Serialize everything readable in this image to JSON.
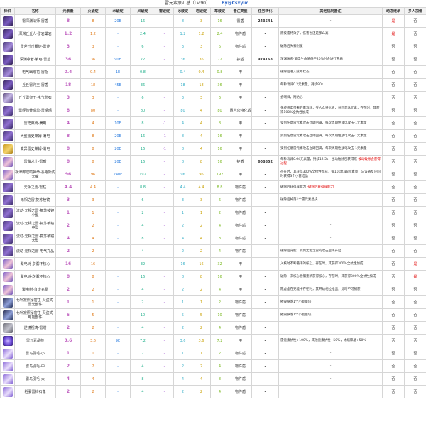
{
  "header": {
    "title": "雷元素原汇总（Lv.90）",
    "author": "By@Csxylic"
  },
  "columns": [
    "标识",
    "名称",
    "元素量",
    "火破绽",
    "水破绽",
    "风破绽",
    "雷破绽",
    "冰破绽",
    "岩破绽",
    "草破绽",
    "备注类型",
    "任务转化",
    "其他机制备注",
    "动态继承",
    "多人加值"
  ],
  "rows": [
    {
      "icon": "boss",
      "name": "雷深渊法师-雷盾",
      "el": "8",
      "fire": "8",
      "water": "20E",
      "wind": "16",
      "thunder": "-",
      "ice": "8",
      "rock": "3",
      "grass": "16",
      "type": "雷盾",
      "task": "243541",
      "note": "-",
      "note_hl": "",
      "dyn": "是",
      "multi": "否",
      "dyn_red": true
    },
    {
      "icon": "boss",
      "name": "深渊丘丘人·雷岩巢岩",
      "el": "1.2",
      "fire": "1.2",
      "water": "-",
      "wind": "2.4",
      "thunder": "-",
      "ice": "1.2",
      "rock": "1.2",
      "grass": "2.4",
      "type": "物件盾",
      "task": "-",
      "note": "而按雷特效了，伤害也还是那么高",
      "note_hl": "",
      "dyn": "是",
      "multi": "否",
      "dyn_red": true
    },
    {
      "icon": "plant",
      "name": "雷斧丘丘暴徒-雷斧",
      "el": "3",
      "fire": "3",
      "water": "-",
      "wind": "6",
      "thunder": "-",
      "ice": "3",
      "rock": "3",
      "grass": "6",
      "type": "物件盾",
      "task": "-",
      "note": "破除后失去附魔",
      "note_hl": "",
      "dyn": "否",
      "multi": "否",
      "dyn_red": false
    },
    {
      "icon": "boss",
      "name": "深渊咏者·紫电-雷盾",
      "el": "36",
      "fire": "36",
      "water": "90E",
      "wind": "72",
      "thunder": "-",
      "ice": "36",
      "rock": "36",
      "grass": "72",
      "type": "护盾",
      "task": "974163",
      "note": "深渊咏者·紫电生命值低于20%时会进行开盾",
      "note_hl": "",
      "dyn": "否",
      "multi": "否",
      "dyn_red": false
    },
    {
      "icon": "plant",
      "name": "电气幽魂花-雷瓶",
      "el": "0.4",
      "fire": "0.4",
      "water": "1E",
      "wind": "0.8",
      "thunder": "-",
      "ice": "0.4",
      "rock": "0.4",
      "grass": "0.8",
      "type": "甲",
      "task": "-",
      "note": "破除后进入眩晕状态",
      "note_hl": "",
      "dyn": "否",
      "multi": "否",
      "dyn_red": false
    },
    {
      "icon": "boss",
      "name": "丘丘雷兜王-雷盾",
      "el": "18",
      "fire": "18",
      "water": "45E",
      "wind": "36",
      "thunder": "-",
      "ice": "18",
      "rock": "18",
      "grass": "36",
      "type": "甲",
      "task": "-",
      "note": "每秒衰减0.2元素量，持续90s",
      "note_hl": "",
      "dyn": "否",
      "multi": "否",
      "dyn_red": false
    },
    {
      "icon": "skull",
      "name": "丘丘雷兜王·电气防石",
      "el": "3",
      "fire": "3",
      "water": "-",
      "wind": "6",
      "thunder": "-",
      "ice": "3",
      "rock": "3",
      "grass": "6",
      "type": "甲",
      "task": "-",
      "note": "会嘲讽，附防心",
      "note_hl": "",
      "dyn": "否",
      "multi": "否",
      "dyn_red": false
    },
    {
      "icon": "chest",
      "name": "雷蛭骸骨晴单-雷晴晴",
      "el": "8",
      "fire": "80",
      "water": "-",
      "wind": "80",
      "thunder": "-",
      "ice": "80",
      "rock": "4",
      "grass": "80",
      "type": "愚人众特化盾",
      "task": "-",
      "note": "免疫感电带来的雷消耗，受人众特化盾，剩点是冰元素，存在时，其获得100%全抗性加成",
      "note_hl": "",
      "dyn": "否",
      "multi": "否",
      "dyn_red": false
    },
    {
      "icon": "chest",
      "name": "雷史莱姆-满电",
      "el": "4",
      "fire": "4",
      "water": "10E",
      "wind": "8",
      "thunder": "-1",
      "ice": "4",
      "rock": "4",
      "grass": "8",
      "type": "甲",
      "task": "-",
      "note": "受到任意雷元素攻击立即回满，每次周期性放电攻击-1元素量",
      "note_hl": "",
      "dyn": "否",
      "multi": "否",
      "dyn_red": false
    },
    {
      "icon": "chest",
      "name": "大型雷史莱姆-满电",
      "el": "8",
      "fire": "8",
      "water": "20E",
      "wind": "16",
      "thunder": "-1",
      "ice": "8",
      "rock": "4",
      "grass": "16",
      "type": "甲",
      "task": "-",
      "note": "受到任意雷元素攻击立即回满，每次周期性放电攻击-1元素量",
      "note_hl": "",
      "dyn": "否",
      "multi": "否",
      "dyn_red": false
    },
    {
      "icon": "gold",
      "name": "变异雷史莱姆-满电",
      "el": "8",
      "fire": "8",
      "water": "20E",
      "wind": "16",
      "thunder": "-1",
      "ice": "8",
      "rock": "4",
      "grass": "16",
      "type": "甲",
      "task": "-",
      "note": "受到任意雷元素攻击立即回满，每次周期性放电攻击-1元素量",
      "note_hl": "",
      "dyn": "否",
      "multi": "否",
      "dyn_red": false
    },
    {
      "icon": "girl",
      "name": "雷萤术士-雷盾",
      "el": "8",
      "fire": "8",
      "water": "20E",
      "wind": "16",
      "thunder": "-",
      "ice": "8",
      "rock": "8",
      "grass": "16",
      "type": "护盾",
      "task": "608852",
      "note": "每秒衰减0.64元素量，持续12.5s，主动破除已获得或",
      "note_hl": "被动破除会获得过程",
      "dyn": "否",
      "multi": "否",
      "dyn_red": false
    },
    {
      "icon": "girl",
      "name": "祸津御建鸣神命-恶曜斯内天魔",
      "el": "96",
      "fire": "96",
      "water": "240E",
      "wind": "192",
      "thunder": "-",
      "ice": "96",
      "rock": "96",
      "grass": "192",
      "type": "甲",
      "task": "-",
      "note": "存在时，其获得300%全抗性加成，每10s衰减8元素量，与该盾反应同时获得3个小雷结晶",
      "note_hl": "",
      "dyn": "否",
      "multi": "否",
      "dyn_red": false
    },
    {
      "icon": "chest",
      "name": "无相之雷·雷柱",
      "el": "4.4",
      "fire": "4.4",
      "water": "-",
      "wind": "8.8",
      "thunder": "-",
      "ice": "4.4",
      "rock": "4.4",
      "grass": "8.8",
      "type": "物件盾",
      "task": "-",
      "note": "破除后获得或能力",
      "note_hl": "-破除后获得或能力",
      "dyn": "否",
      "multi": "否",
      "dyn_red": false
    },
    {
      "icon": "chest",
      "name": "无相之雷·复苏棱镜",
      "el": "3",
      "fire": "3",
      "water": "-",
      "wind": "6",
      "thunder": "-",
      "ice": "3",
      "rock": "3",
      "grass": "6",
      "type": "物件盾",
      "task": "-",
      "note": "破除后掉落1个雷元素晶块",
      "note_hl": "",
      "dyn": "否",
      "multi": "否",
      "dyn_red": false
    },
    {
      "icon": "chest",
      "name": "流动·无相之雷·复苏棱镜小型",
      "el": "1",
      "fire": "1",
      "water": "-",
      "wind": "2",
      "thunder": "-",
      "ice": "1",
      "rock": "1",
      "grass": "2",
      "type": "物件盾",
      "task": "-",
      "note": "-",
      "note_hl": "",
      "dyn": "否",
      "multi": "否",
      "dyn_red": false
    },
    {
      "icon": "chest",
      "name": "流动·无相之雷·复苏棱镜中型",
      "el": "2",
      "fire": "2",
      "water": "-",
      "wind": "4",
      "thunder": "-",
      "ice": "2",
      "rock": "2",
      "grass": "4",
      "type": "物件盾",
      "task": "-",
      "note": "-",
      "note_hl": "",
      "dyn": "否",
      "multi": "否",
      "dyn_red": false
    },
    {
      "icon": "chest",
      "name": "流动·无相之雷·复苏棱镜大型",
      "el": "4",
      "fire": "4",
      "water": "-",
      "wind": "8",
      "thunder": "-",
      "ice": "4",
      "rock": "4",
      "grass": "8",
      "type": "物件盾",
      "task": "-",
      "note": "-",
      "note_hl": "",
      "dyn": "否",
      "multi": "否",
      "dyn_red": false
    },
    {
      "icon": "chest",
      "name": "流动·无相之雷·电气充晶",
      "el": "2",
      "fire": "2",
      "water": "-",
      "wind": "4",
      "thunder": "-",
      "ice": "2",
      "rock": "2",
      "grass": "4",
      "type": "物件盾",
      "task": "-",
      "note": "破除后充能，受到无相之雷的攻击后再开启",
      "note_hl": "",
      "dyn": "否",
      "multi": "否",
      "dyn_red": false
    },
    {
      "icon": "girl",
      "name": "聚电树-泉循环核心",
      "el": "16",
      "fire": "16",
      "water": "-",
      "wind": "32",
      "thunder": "-",
      "ice": "16",
      "rock": "16",
      "grass": "32",
      "type": "甲",
      "task": "-",
      "note": "入核时不断循环的核心，存在时，其获得300%全抗性加成",
      "note_hl": "",
      "dyn": "否",
      "multi": "是",
      "dyn_red": false
    },
    {
      "icon": "girl",
      "name": "聚电树-次循环核心",
      "el": "8",
      "fire": "8",
      "water": "-",
      "wind": "16",
      "thunder": "-",
      "ice": "8",
      "rock": "8",
      "grass": "16",
      "type": "甲",
      "task": "-",
      "note": "破除一次核心恐惧重新获得核心，存在时，其获得300%全抗性加成",
      "note_hl": "",
      "dyn": "否",
      "multi": "是",
      "dyn_red": false
    },
    {
      "icon": "girl",
      "name": "聚电树-直虚充晶",
      "el": "2",
      "fire": "2",
      "water": "-",
      "wind": "4",
      "thunder": "-",
      "ice": "2",
      "rock": "2",
      "grass": "4",
      "type": "甲",
      "task": "-",
      "note": "陈虚虚在充能中存在时，其开始相拉推出，此时不可捕获",
      "note_hl": "",
      "dyn": "否",
      "multi": "否",
      "dyn_red": false
    },
    {
      "icon": "shrine",
      "name": "七叶寂照秘密主·灭盗式-雷光部件",
      "el": "1",
      "fire": "1",
      "water": "-",
      "wind": "2",
      "thunder": "-",
      "ice": "1",
      "rock": "1",
      "grass": "2",
      "type": "物件盾",
      "task": "-",
      "note": "摧毁掉落1个小能量块",
      "note_hl": "",
      "dyn": "否",
      "multi": "否",
      "dyn_red": false
    },
    {
      "icon": "shrine",
      "name": "七叶寂照秘密主·灭盗式-电能部件",
      "el": "5",
      "fire": "5",
      "water": "-",
      "wind": "10",
      "thunder": "-",
      "ice": "5",
      "rock": "5",
      "grass": "10",
      "type": "物件盾",
      "task": "-",
      "note": "摧毁掉落1个小能量块",
      "note_hl": "",
      "dyn": "否",
      "multi": "否",
      "dyn_red": false
    },
    {
      "icon": "stone",
      "name": "逆镜祝祷-雷塔",
      "el": "2",
      "fire": "2",
      "water": "-",
      "wind": "4",
      "thunder": "-",
      "ice": "2",
      "rock": "2",
      "grass": "4",
      "type": "物件盾",
      "task": "-",
      "note": "-",
      "note_hl": "",
      "dyn": "否",
      "multi": "否",
      "dyn_red": false
    },
    {
      "icon": "orb",
      "name": "雷元素晶核",
      "el": "3.6",
      "fire": "3.6",
      "water": "9E",
      "wind": "7.2",
      "thunder": "-",
      "ice": "3.6",
      "rock": "3.6",
      "grass": "7.2",
      "type": "甲",
      "task": "-",
      "note": "雷元素抗性+100%，其他元素抗性+50%，冰结碎晶+50%",
      "note_hl": "",
      "dyn": "否",
      "multi": "否",
      "dyn_red": false
    },
    {
      "icon": "book",
      "name": "雷鸟羽毛-小",
      "el": "1",
      "fire": "1",
      "water": "-",
      "wind": "2",
      "thunder": "-",
      "ice": "1",
      "rock": "1",
      "grass": "2",
      "type": "物件盾",
      "task": "-",
      "note": "-",
      "note_hl": "",
      "dyn": "否",
      "multi": "否",
      "dyn_red": false
    },
    {
      "icon": "book",
      "name": "雷鸟羽毛-中",
      "el": "2",
      "fire": "2",
      "water": "-",
      "wind": "4",
      "thunder": "-",
      "ice": "2",
      "rock": "2",
      "grass": "4",
      "type": "物件盾",
      "task": "-",
      "note": "-",
      "note_hl": "",
      "dyn": "否",
      "multi": "否",
      "dyn_red": false
    },
    {
      "icon": "book",
      "name": "雷鸟羽毛-大",
      "el": "4",
      "fire": "4",
      "water": "-",
      "wind": "8",
      "thunder": "-",
      "ice": "4",
      "rock": "4",
      "grass": "8",
      "type": "物件盾",
      "task": "-",
      "note": "-",
      "note_hl": "",
      "dyn": "否",
      "multi": "否",
      "dyn_red": false
    },
    {
      "icon": "book",
      "name": "稻妻雷铃石像",
      "el": "2",
      "fire": "2",
      "water": "-",
      "wind": "4",
      "thunder": "-",
      "ice": "2",
      "rock": "2",
      "grass": "4",
      "type": "物件盾",
      "task": "-",
      "note": "-",
      "note_hl": "",
      "dyn": "否",
      "multi": "否",
      "dyn_red": false
    }
  ],
  "colors": {
    "element": "#c060c0",
    "fire": "#e07b1a",
    "water": "#2f7fe0",
    "wind": "#22b08c",
    "thunder": "#a050d0",
    "ice": "#38b0c8",
    "rock": "#c9a000",
    "grass": "#7ab820",
    "highlight": "#e00000"
  }
}
